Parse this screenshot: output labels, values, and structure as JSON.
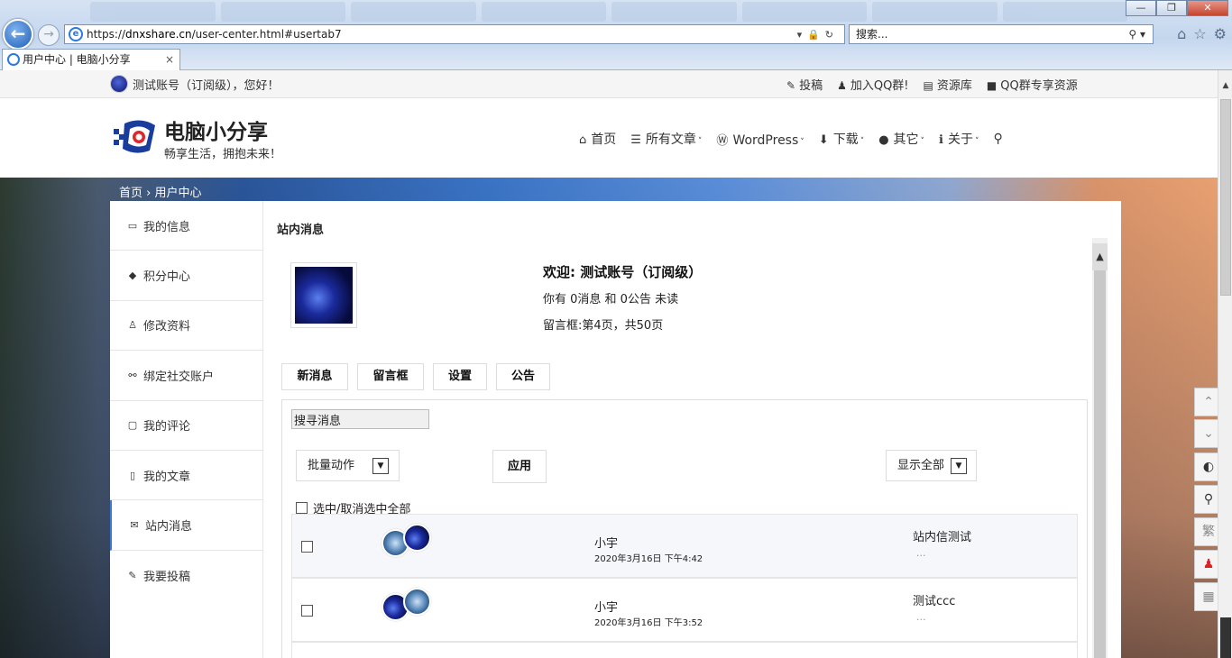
{
  "browser": {
    "url_prefix": "https://",
    "url_domain": "dnxshare.cn",
    "url_path": "/user-center.html#usertab7",
    "search_placeholder": "搜索...",
    "tab_title": "用户中心 | 电脑小分享",
    "tab_close": "×",
    "win_min": "—",
    "win_max": "❐",
    "win_close": "✕"
  },
  "topbar": {
    "greeting": "测试账号（订阅级），您好！",
    "links": [
      {
        "icon": "edit-icon",
        "glyph": "✎",
        "label": "投稿"
      },
      {
        "icon": "qq-icon",
        "glyph": "♟",
        "label": "加入QQ群!"
      },
      {
        "icon": "document-icon",
        "glyph": "▤",
        "label": "资源库"
      },
      {
        "icon": "folder-icon",
        "glyph": "■",
        "label": "QQ群专享资源"
      }
    ]
  },
  "header": {
    "site_name": "电脑小分享",
    "slogan": "畅享生活，拥抱未来！",
    "nav": [
      {
        "icon": "home-icon",
        "glyph": "⌂",
        "label": "首页",
        "dropdown": false
      },
      {
        "icon": "list-icon",
        "glyph": "☰",
        "label": "所有文章",
        "dropdown": true
      },
      {
        "icon": "wordpress-icon",
        "glyph": "Ⓦ",
        "label": "WordPress",
        "dropdown": true
      },
      {
        "icon": "download-icon",
        "glyph": "⬇",
        "label": "下载",
        "dropdown": true
      },
      {
        "icon": "more-icon",
        "glyph": "●",
        "label": "其它",
        "dropdown": true
      },
      {
        "icon": "info-icon",
        "glyph": "ℹ",
        "label": "关于",
        "dropdown": true
      }
    ],
    "chev": "˅"
  },
  "breadcrumb": "首页 › 用户中心",
  "sidebar": {
    "items": [
      {
        "icon": "id-card-icon",
        "glyph": "▭",
        "label": "我的信息"
      },
      {
        "icon": "diamond-icon",
        "glyph": "◆",
        "label": "积分中心"
      },
      {
        "icon": "user-icon",
        "glyph": "♙",
        "label": "修改资料"
      },
      {
        "icon": "link-icon",
        "glyph": "⚯",
        "label": "绑定社交账户"
      },
      {
        "icon": "comment-icon",
        "glyph": "▢",
        "label": "我的评论"
      },
      {
        "icon": "file-icon",
        "glyph": "▯",
        "label": "我的文章"
      },
      {
        "icon": "mail-icon",
        "glyph": "✉",
        "label": "站内消息"
      },
      {
        "icon": "pencil-icon",
        "glyph": "✎",
        "label": "我要投稿"
      }
    ],
    "active_index": 6
  },
  "main": {
    "title": "站内消息",
    "welcome": "欢迎: 测试账号（订阅级）",
    "unread": "你有 0消息 和 0公告 未读",
    "page_info": "留言框:第4页，共50页",
    "tabs": [
      "新消息",
      "留言框",
      "设置",
      "公告"
    ],
    "search_value": "搜寻消息",
    "bulk_action": "批量动作",
    "apply": "应用",
    "filter": "显示全部",
    "select_all": "选中/取消选中全部",
    "messages": [
      {
        "sender": "小宇",
        "time": "2020年3月16日 下午4:42",
        "subject": "站内信测试",
        "excerpt": "..."
      },
      {
        "sender": "小宇",
        "time": "2020年3月16日 下午3:52",
        "subject": "测试ccc",
        "excerpt": "..."
      }
    ]
  },
  "floating_tools": [
    {
      "icon": "arrow-up-icon",
      "glyph": "⌃"
    },
    {
      "icon": "arrow-down-icon",
      "glyph": "⌄"
    },
    {
      "icon": "contrast-icon",
      "glyph": "◐"
    },
    {
      "icon": "search-icon",
      "glyph": "⚲"
    },
    {
      "icon": "traditional-chinese-icon",
      "glyph": "繁"
    },
    {
      "icon": "qq-service-icon",
      "glyph": "♟"
    },
    {
      "icon": "qrcode-icon",
      "glyph": "▦"
    }
  ]
}
